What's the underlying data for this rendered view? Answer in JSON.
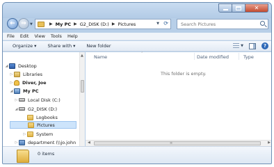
{
  "breadcrumb": [
    "My PC",
    "G2_DISK (D:)",
    "Pictures"
  ],
  "search": {
    "placeholder": "Search Pictures"
  },
  "menu": [
    "File",
    "Edit",
    "View",
    "Tools",
    "Help"
  ],
  "toolbar": {
    "organize": "Organize ▾",
    "share_with": "Share with ▾",
    "new_folder": "New folder"
  },
  "nav_tree": [
    {
      "label": "Desktop",
      "icon": "desktop-icon"
    },
    {
      "label": "Libraries",
      "icon": "libraries-icon"
    },
    {
      "label": "Diver, Joe",
      "icon": "user-folder-icon"
    },
    {
      "label": "My PC",
      "icon": "computer-icon"
    },
    {
      "label": "Local Disk (C:)",
      "icon": "drive-icon"
    },
    {
      "label": "G2_DISK (D:)",
      "icon": "drive-icon"
    },
    {
      "label": "Logbooks",
      "icon": "folder-icon"
    },
    {
      "label": "Pictures",
      "icon": "folder-icon"
    },
    {
      "label": "System",
      "icon": "folder-icon"
    },
    {
      "label": "department (\\\\jo.john",
      "icon": "network-drive-icon"
    }
  ],
  "columns": [
    "Name",
    "Date modified",
    "Type"
  ],
  "empty_message": "This folder is empty.",
  "status": {
    "items_count": "0 items"
  },
  "colors": {
    "window_frame": "#b8cfe8",
    "selection": "#cde4fb",
    "close_button": "#c24a2f",
    "folder": "#e1b448"
  }
}
